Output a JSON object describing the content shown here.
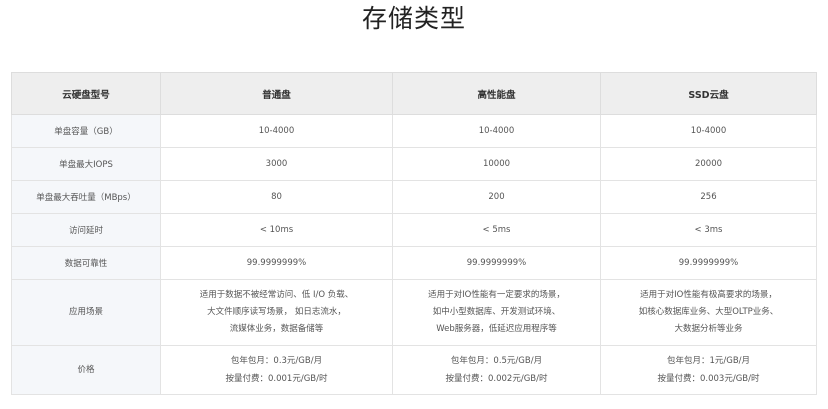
{
  "title": "存储类型",
  "table": {
    "headers": [
      "云硬盘型号",
      "普通盘",
      "高性能盘",
      "SSD云盘"
    ],
    "rows": [
      {
        "label": "单盘容量（GB）",
        "cells": [
          "10-4000",
          "10-4000",
          "10-4000"
        ]
      },
      {
        "label": "单盘最大IOPS",
        "cells": [
          "3000",
          "10000",
          "20000"
        ]
      },
      {
        "label": "单盘最大吞吐量（MBps）",
        "cells": [
          "80",
          "200",
          "256"
        ]
      },
      {
        "label": "访问延时",
        "cells": [
          "< 10ms",
          "< 5ms",
          "< 3ms"
        ]
      },
      {
        "label": "数据可靠性",
        "cells": [
          "99.9999999%",
          "99.9999999%",
          "99.9999999%"
        ]
      }
    ],
    "scenario": {
      "label": "应用场景",
      "cells": [
        [
          "适用于数据不被经常访问、低 I/O 负载、",
          "大文件顺序读写场景， 如日志流水，",
          "流媒体业务，数据备储等"
        ],
        [
          "适用于对IO性能有一定要求的场景，",
          "如中小型数据库、开发测试环境、",
          "Web服务器，低延迟应用程序等"
        ],
        [
          "适用于对IO性能有极高要求的场景，",
          "如核心数据库业务、大型OLTP业务、",
          "大数据分析等业务"
        ]
      ]
    },
    "price": {
      "label": "价格",
      "cells": [
        [
          "包年包月：0.3元/GB/月",
          "按量付费：0.001元/GB/时"
        ],
        [
          "包年包月：0.5元/GB/月",
          "按量付费：0.002元/GB/时"
        ],
        [
          "包年包月：1元/GB/月",
          "按量付费：0.003元/GB/时"
        ]
      ]
    }
  }
}
